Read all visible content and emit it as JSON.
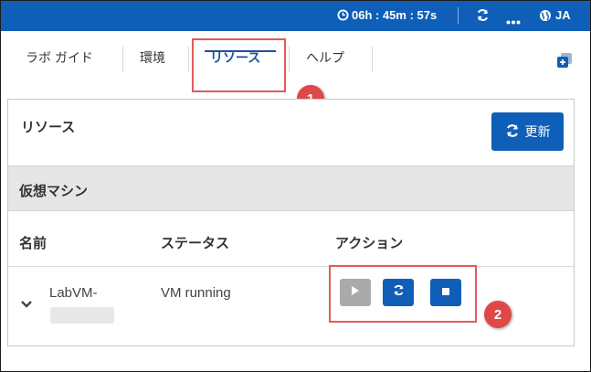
{
  "topbar": {
    "timer": "06h : 45m : 57s",
    "language": "JA",
    "icons": [
      "clock-icon",
      "refresh-icon",
      "more-icon",
      "globe-icon"
    ]
  },
  "tabs": [
    {
      "label": "ラボ ガイド",
      "active": false
    },
    {
      "label": "環境",
      "active": false
    },
    {
      "label": "リソース",
      "active": true
    },
    {
      "label": "ヘルプ",
      "active": false
    }
  ],
  "annotations": {
    "badge1": "1",
    "badge2": "2"
  },
  "panel": {
    "title": "リソース",
    "refresh_label": "更新",
    "section_title": "仮想マシン",
    "columns": [
      "名前",
      "ステータス",
      "アクション"
    ],
    "vm": {
      "name": "LabVM-",
      "status": "VM running",
      "actions": [
        "start-icon",
        "restart-icon",
        "stop-icon"
      ]
    }
  },
  "colors": {
    "primary": "#0f5fb8",
    "annotation_red": "#e04848",
    "disabled_gray": "#aaaaaa",
    "section_bg": "#e6e6e6"
  }
}
